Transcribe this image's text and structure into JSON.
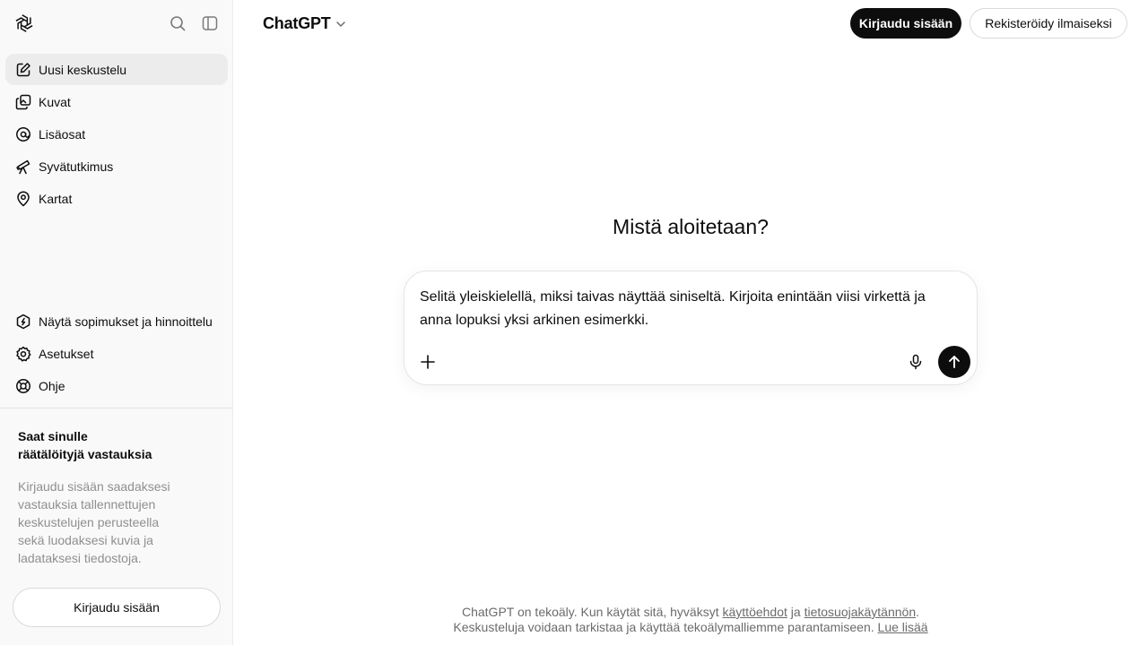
{
  "sidebar": {
    "logo_icon": "openai-logo-icon",
    "search_icon": "search-icon",
    "toggle_icon": "sidebar-toggle-icon",
    "nav": [
      {
        "label": "Uusi keskustelu",
        "icon": "new-chat-icon",
        "active": true
      },
      {
        "label": "Kuvat",
        "icon": "images-icon"
      },
      {
        "label": "Lisäosat",
        "icon": "apps-icon"
      },
      {
        "label": "Syvätutkimus",
        "icon": "telescope-icon"
      },
      {
        "label": "Kartat",
        "icon": "map-pin-icon"
      }
    ],
    "bottom_nav": [
      {
        "label": "Näytä sopimukset ja hinnoittelu",
        "icon": "plans-icon"
      },
      {
        "label": "Asetukset",
        "icon": "gear-icon"
      },
      {
        "label": "Ohje",
        "icon": "help-lifebuoy-icon"
      }
    ],
    "promo": {
      "title_line1": "Saat sinulle",
      "title_line2": "räätälöityjä vastauksia",
      "text": "Kirjaudu sisään saadaksesi vastauksia tallennettujen keskustelujen perusteella sekä luodaksesi kuvia ja ladataksesi tiedostoja."
    },
    "login_label": "Kirjaudu sisään"
  },
  "header": {
    "model_name": "ChatGPT",
    "login_label": "Kirjaudu sisään",
    "register_label": "Rekisteröidy ilmaiseksi"
  },
  "main": {
    "heading": "Mistä aloitetaan?",
    "composer": {
      "value": "Selitä yleiskielellä, miksi taivas näyttää siniseltä. Kirjoita enintään viisi virkettä ja anna lopuksi yksi arkinen esimerkki.",
      "plus_icon": "plus-icon",
      "mic_icon": "microphone-icon",
      "send_icon": "arrow-up-icon"
    }
  },
  "footer": {
    "line1_text": "ChatGPT on tekoäly. Kun käytät sitä, hyväksyt ",
    "terms_link": "käyttöehdot",
    "and": " ja ",
    "privacy_link": "tietosuojakäytännön",
    "line1_end": ".",
    "line2_text": "Keskusteluja voidaan tarkistaa ja käyttää tekoälymalliemme parantamiseen. ",
    "learn_more": "Lue lisää"
  },
  "colors": {
    "sidebar_bg": "#f9f9f9",
    "active_bg": "#ececec",
    "primary": "#0d0d0d",
    "muted_text": "#8f8f8f"
  }
}
